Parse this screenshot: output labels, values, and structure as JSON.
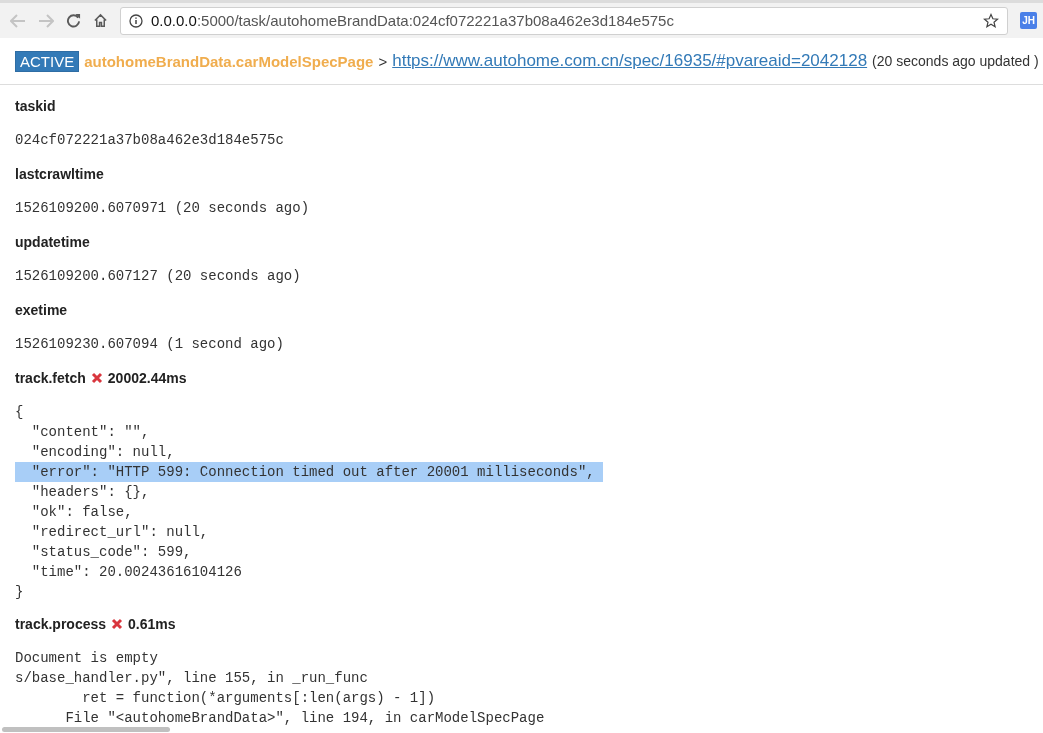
{
  "browser": {
    "address_host": "0.0.0.0",
    "address_path": ":5000/task/autohomeBrandData:024cf072221a37b08a462e3d184e575c",
    "profile": "JH"
  },
  "header": {
    "status": "ACTIVE",
    "project_callback": "autohomeBrandData.carModelSpecPage",
    "separator": ">",
    "url": "https://www.autohome.com.cn/spec/16935/#pvareaid=2042128",
    "updated": "(20 seconds ago updated )"
  },
  "fields": [
    {
      "label": "taskid",
      "value": "024cf072221a37b08a462e3d184e575c"
    },
    {
      "label": "lastcrawltime",
      "value": "1526109200.6070971 (20 seconds ago)"
    },
    {
      "label": "updatetime",
      "value": "1526109200.607127 (20 seconds ago)"
    },
    {
      "label": "exetime",
      "value": "1526109230.607094 (1 second ago)"
    }
  ],
  "tracks": [
    {
      "name": "track.fetch",
      "ok": false,
      "duration": "20002.44ms",
      "lines": [
        {
          "text": "{",
          "selected": false
        },
        {
          "text": "  \"content\": \"\",",
          "selected": false
        },
        {
          "text": "  \"encoding\": null,",
          "selected": false
        },
        {
          "text": "  \"error\": \"HTTP 599: Connection timed out after 20001 milliseconds\",",
          "selected": true
        },
        {
          "text": "  \"headers\": {},",
          "selected": false
        },
        {
          "text": "  \"ok\": false,",
          "selected": false
        },
        {
          "text": "  \"redirect_url\": null,",
          "selected": false
        },
        {
          "text": "  \"status_code\": 599,",
          "selected": false
        },
        {
          "text": "  \"time\": 20.00243616104126",
          "selected": false
        },
        {
          "text": "}",
          "selected": false
        }
      ]
    },
    {
      "name": "track.process",
      "ok": false,
      "duration": "0.61ms",
      "lines": [
        {
          "text": "Document is empty",
          "selected": false
        },
        {
          "text": "s/base_handler.py\", line 155, in _run_func",
          "selected": false
        },
        {
          "text": "        ret = function(*arguments[:len(args) - 1])",
          "selected": false
        },
        {
          "text": "      File \"<autohomeBrandData>\", line 194, in carModelSpecPage",
          "selected": false
        }
      ]
    }
  ]
}
